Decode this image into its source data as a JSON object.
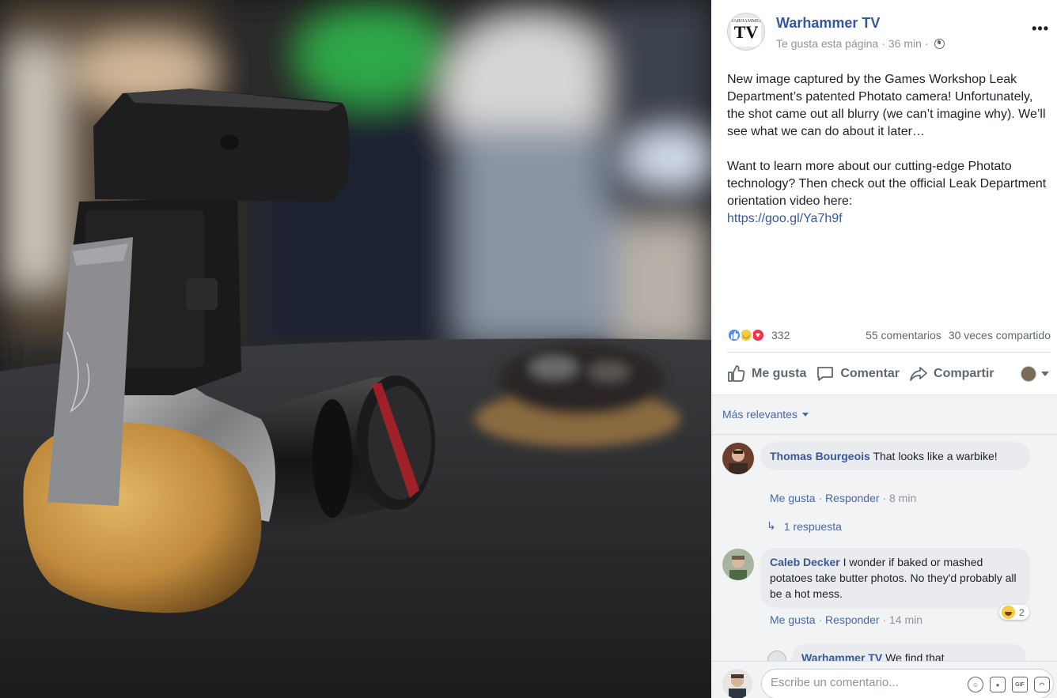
{
  "page": {
    "name": "Warhammer TV",
    "avatar_wordmark": "WARHAMMER",
    "avatar_monogram": "TV",
    "liked": "Te gusta esta página",
    "time": "36 min",
    "separator": "·"
  },
  "post": {
    "paragraph1": "New image captured by the Games Workshop Leak Department’s patented Photato camera! Unfortunately, the shot came out all blurry (we can’t imagine why). We’ll see what we can do about it later…",
    "paragraph2": "Want to learn more about our cutting-edge Photato technology? Then check out the official Leak Department orientation video here:",
    "link": "https://goo.gl/Ya7h9f"
  },
  "stats": {
    "reactions_count": "332",
    "comments": "55 comentarios",
    "shares": "30 veces compartido"
  },
  "actions": {
    "like": "Me gusta",
    "comment": "Comentar",
    "share": "Compartir"
  },
  "comments_sort": "Más relevantes",
  "comments": [
    {
      "author": "Thomas Bourgeois",
      "text": "That looks like a warbike!",
      "like": "Me gusta",
      "reply": "Responder",
      "time": "8 min",
      "replies": "1 respuesta"
    },
    {
      "author": "Caleb Decker",
      "text": "I wonder if baked or mashed potatoes take butter photos. No they'd probably all be a hot mess.",
      "like": "Me gusta",
      "reply": "Responder",
      "time": "14 min",
      "reaction_count": "2"
    },
    {
      "author": "Warhammer TV",
      "text": "We find that"
    }
  ],
  "composer": {
    "placeholder": "Escribe un comentario..."
  },
  "colors": {
    "link_blue": "#365899",
    "muted": "#90949c",
    "panel_bg": "#f2f3f5"
  }
}
